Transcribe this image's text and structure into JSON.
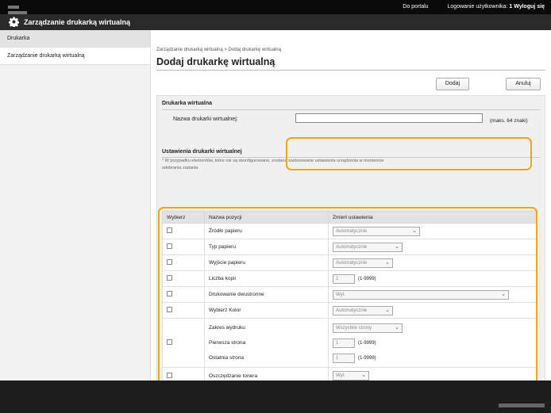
{
  "top_links": {
    "portal": "Do portalu",
    "login_user_label": "Logowanie użytkownika:",
    "login_user_value": "1",
    "logout": "Wyloguj się"
  },
  "app": {
    "title": "Zarządzanie drukarką wirtualną"
  },
  "sidebar": {
    "items": [
      {
        "label": "Drukarka"
      },
      {
        "label": "Zarządzanie drukarką wirtualną"
      }
    ]
  },
  "breadcrumb": "Zarządzanie drukarką wirtualną > Dodaj drukarkę wirtualną",
  "page_title": "Dodaj drukarkę wirtualną",
  "buttons": {
    "add": "Dodaj",
    "cancel": "Anuluj"
  },
  "virtual_printer": {
    "section_title": "Drukarka wirtualna",
    "name_label": "Nazwa drukarki wirtualnej:",
    "name_value": "",
    "name_hint": "(maks. 64 znaki)"
  },
  "settings": {
    "section_title": "Ustawienia drukarki wirtualnej",
    "note": "* W przypadku elementów, które nie są skonfigurowane, zostaną zastosowane ustawienia urządzenia w momencie odebrania zadania.",
    "columns": [
      "Wybierz",
      "Nazwa pozycji",
      "Zmień ustawienia"
    ],
    "rows": {
      "paper_source": {
        "name": "Źródło papieru",
        "value": "Automatycznie"
      },
      "paper_type": {
        "name": "Typ papieru",
        "value": "Automatycznie"
      },
      "paper_output": {
        "name": "Wyjście papieru",
        "value": "Automatycznie"
      },
      "copies": {
        "name": "Liczba kopii",
        "value": "1",
        "range": "(1-9999)"
      },
      "duplex": {
        "name": "Drukowanie dwustronne",
        "value": "Wył."
      },
      "color": {
        "name": "Wybierz Kolor",
        "value": "Automatycznie"
      },
      "print_range": {
        "name": "Zakres wydruku",
        "value": "Wszystkie strony",
        "first_name": "Pierwsza strona",
        "first_value": "1",
        "first_range": "(1-9999)",
        "last_name": "Ostatnia strona",
        "last_value": "1",
        "last_range": "(1-9999)"
      },
      "toner_save": {
        "name": "Oszczędzanie tonera",
        "value": "Wył."
      }
    }
  },
  "scroll_top": "▲",
  "colors": {
    "highlight": "#f2a417",
    "topbar": "#0a0a0a",
    "titlebar": "#2a2a2a",
    "footer": "#1d1d1d"
  }
}
